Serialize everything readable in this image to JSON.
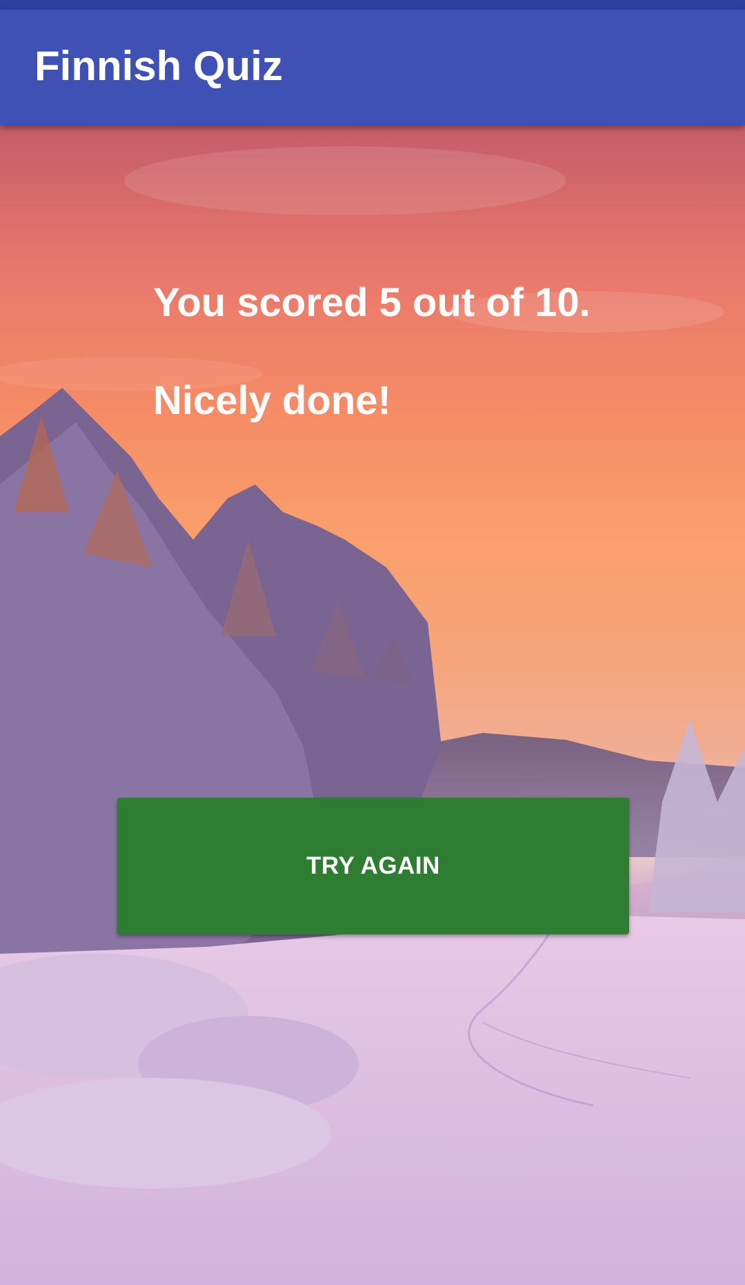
{
  "app": {
    "title": "Finnish Quiz",
    "toolbar_color": "#3f51b5",
    "status_bar_color": "#2f3f9e"
  },
  "result": {
    "score_text": "You scored 5 out of 10.",
    "message": "Nicely done!"
  },
  "actions": {
    "try_again_label": "TRY AGAIN",
    "button_color": "#2e7d32"
  },
  "background": {
    "image": "snowy-forest-sunset-photo"
  }
}
